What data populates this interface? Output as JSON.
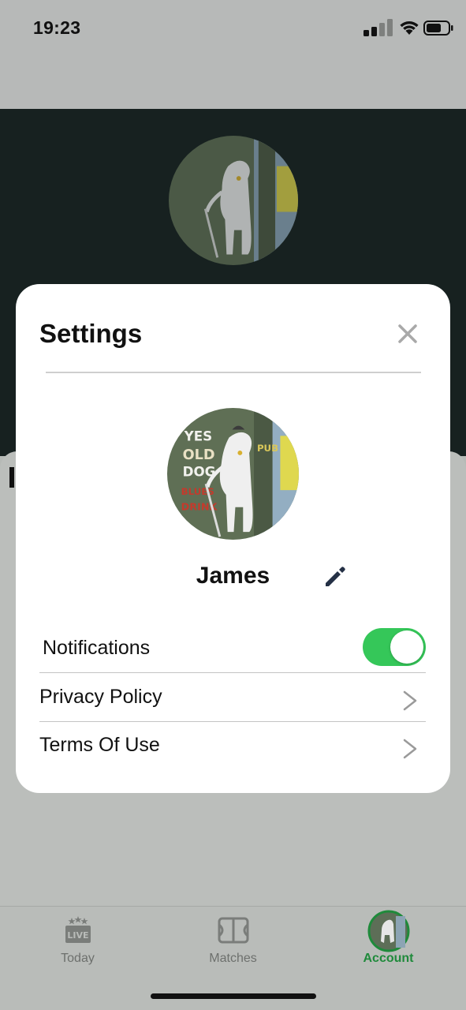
{
  "status_bar": {
    "time": "19:23",
    "icons": [
      "signal-icon",
      "wifi-icon",
      "battery-icon"
    ]
  },
  "settings": {
    "title": "Settings",
    "user_name": "James",
    "avatar_sign_text": [
      "YES",
      "OLD",
      "DOG",
      "BLUES",
      "DRINK",
      "PUB"
    ],
    "rows": {
      "notifications": {
        "label": "Notifications",
        "toggle_on": true
      },
      "privacy": {
        "label": "Privacy Policy"
      },
      "terms": {
        "label": "Terms Of Use"
      }
    }
  },
  "tab_bar": {
    "tabs": [
      {
        "label": "Today",
        "icon": "live-icon",
        "active": false
      },
      {
        "label": "Matches",
        "icon": "pitch-icon",
        "active": false
      },
      {
        "label": "Account",
        "icon": "avatar-icon",
        "active": true
      }
    ]
  },
  "colors": {
    "toggle_on": "#35c759",
    "active_tab": "#1f8a3b",
    "hero_bg": "#172120",
    "edit_icon": "#243045"
  }
}
